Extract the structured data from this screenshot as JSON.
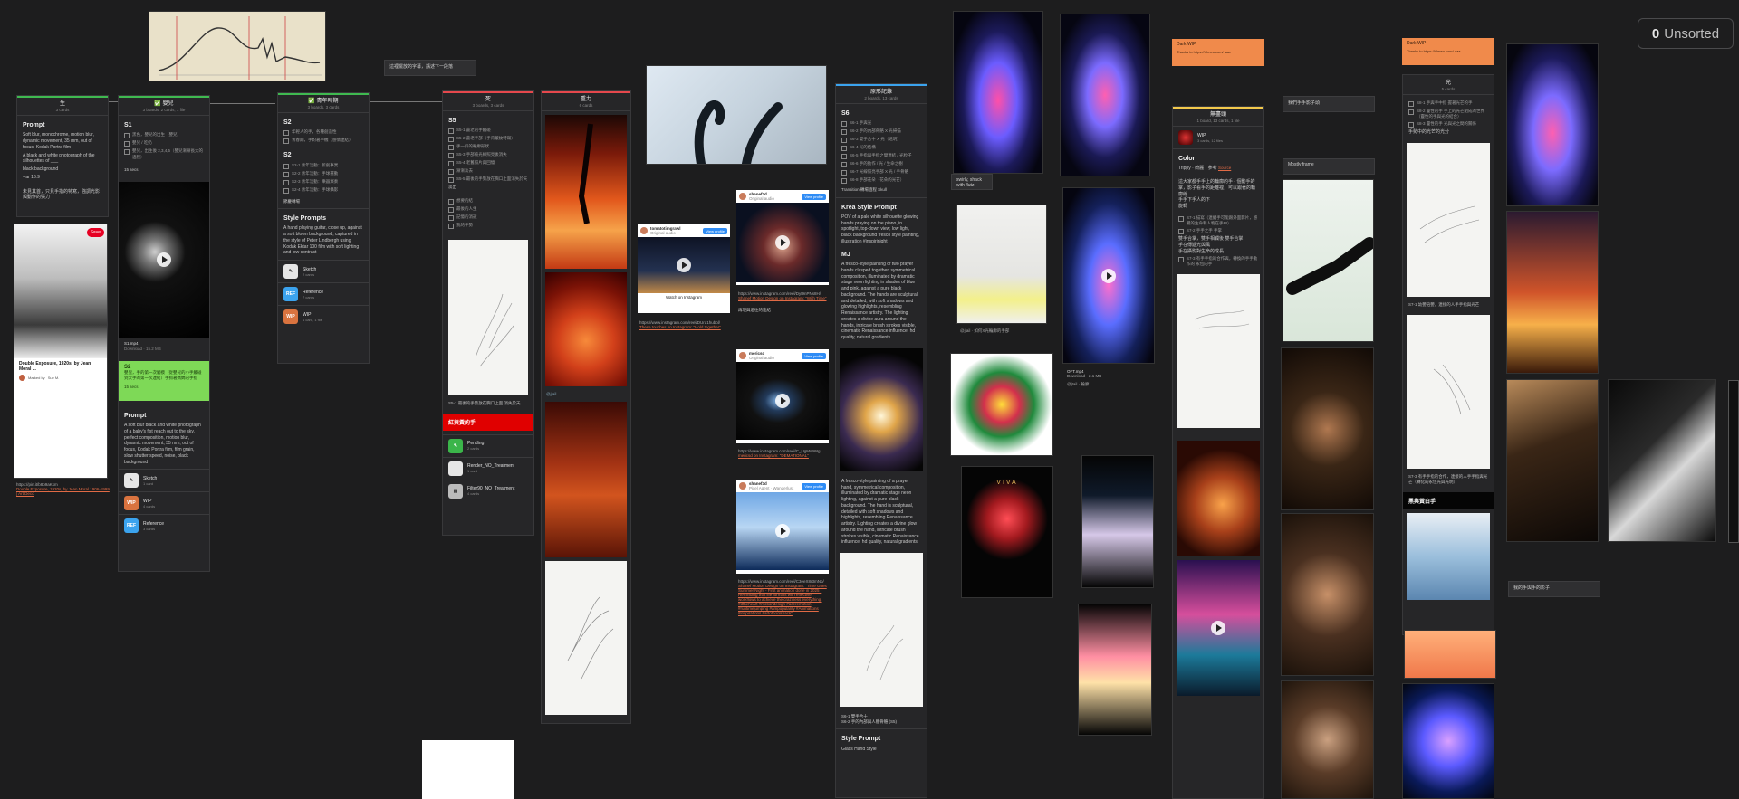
{
  "unsorted": {
    "count": "0",
    "label": "Unsorted"
  },
  "boards": {
    "col1": {
      "title": "生",
      "sub": "3 cards",
      "prompt_heading": "Prompt",
      "prompt_text": "Soft blur, monochrome, motion blur, dynamic movement, 35 mm, out of focus, Kodak Portra film",
      "prompt_text2": "A black and white photograph of the silhouettes of ___",
      "prompt_text3": "black background",
      "prompt_text4": "--ar 16:9",
      "footer_text": "未見其首，只見手指的特寫，強調光影與動作的張力"
    },
    "col2": {
      "title": "✅ 嬰兒",
      "sub": "3 boards, 2 cards, 1 file",
      "s1": "S1",
      "items": [
        "黑色，嬰兒的出生（嬰兒）",
        "嬰兒 / 吃奶",
        "嬰兒，出生後 2,3,4,5（嬰兒漸漸長大的過程）"
      ],
      "seconds": "15 secs",
      "video_file": "S1.mp4",
      "video_meta": "Download · 15.2 MB",
      "s2_title": "S2",
      "s2_text": "嬰兒，手的第一次觸摸（從嬰兒的小手觸碰到大手的第一次連結）手抓著媽媽的手指",
      "s2_secs": "15 secs",
      "prompt_heading": "Prompt",
      "prompt_text": "A soft blur black and white photograph of a baby's fist reach out to the sky, perfect composition, motion blur, dynamic movement, 35 mm, out of focus, Kodak Portra film, film grain, slow shutter speed, noise, black background",
      "subboards": [
        {
          "name": "Sketch",
          "count": "1 card",
          "color": "#e6e6e6",
          "abbr": ""
        },
        {
          "name": "WIP",
          "count": "4 cards",
          "color": "#d9733f",
          "abbr": "WIP"
        },
        {
          "name": "Reference",
          "count": "3 cards",
          "color": "#3ba3ee",
          "abbr": "REF"
        }
      ]
    },
    "col3": {
      "title": "✅ 青年時期",
      "sub": "3 boards, 3 cards",
      "s2": "S2",
      "items1": [
        "年輕人的手，各種創造性",
        "青春期，手對著手機（感情連結）"
      ],
      "s2b": "S2",
      "items2": [
        "S2-1 青年活動：新創事業",
        "S2-2 青年活動：手球運動",
        "S2-3 青年活動：樂器演奏",
        "S2-4 青年活動：手球攝影"
      ],
      "extra": "節慶轉場",
      "style_heading": "Style Prompts",
      "style_text": "A hand playing guitar, close up, against a soft blown background, captured in the style of Peter Lindbergh using Kodak Ektar 100 film with soft lighting and low contrast",
      "subboards": [
        {
          "name": "Sketch",
          "count": "2 cards",
          "color": "#e6e6e6",
          "abbr": ""
        },
        {
          "name": "Reference",
          "count": "7 cards",
          "color": "#3ba3ee",
          "abbr": "REF"
        },
        {
          "name": "WIP",
          "count": "1 card, 1 file",
          "color": "#d9733f",
          "abbr": "WIP"
        }
      ]
    },
    "col4": {
      "title": "死",
      "sub": "3 boards, 3 cards",
      "s5": "S5",
      "items": [
        "S5-1 蒼老的手觸碰",
        "S5-2 蒼老手部（手背皺紋特寫）",
        "手一抖的輪廓形狀",
        "S5-3 手部被光線照亮後消失",
        "S5-4 老舊照片與回憶",
        "漸漸淡去",
        "S5-5 最後的手勢放在胸口上面消失於天"
      ],
      "fade": "淡出",
      "items2": [
        "想要的結",
        "最後的人生",
        "記憶的消逝",
        "我的手勢"
      ],
      "sketch_note": "S5-1 最後的手勢放在胸口上面 消失於天",
      "red_banner": "紅與黃的手",
      "subboards": [
        {
          "name": "Pending",
          "count": "2 cards",
          "color": "#3bb54a",
          "abbr": ""
        },
        {
          "name": "Render_NO_Treatment",
          "count": "1 card",
          "color": "#e6e6e6",
          "abbr": ""
        },
        {
          "name": "Filter90_NO_Treatment",
          "count": "4 cards",
          "color": "#bbbbbb",
          "abbr": ""
        }
      ]
    },
    "col5": {
      "title": "重力",
      "sub": "6 cards",
      "tag": "@jtail"
    },
    "col6": {
      "title": "原形記錄",
      "sub": "2 boards, 13 cards",
      "s6": "S6",
      "items": [
        "S6-1 手與光",
        "S6-2 手的內部骨骼 X 光掃描",
        "S6-3 雙手合十 X 光（透明）",
        "S6-4 光的結構",
        "S6-5 手指與手指之間連結 / 光粒子",
        "S6-6 手的動作 / 光 / 生命之樹",
        "S6-7 光線照亮手部 X 光 / 手骨骼",
        "S6-8 手部花朵（花朵的光芒）"
      ],
      "transition": "Transition 轉場過程 Skull",
      "krea_heading": "Krea Style Prompt",
      "krea_text": "POV of a pale white silhouette glowing hands praying on the piano, in spotlight, top-down view, low light, black background fresco style painting, illustration #inspirinight",
      "mj_heading": "MJ",
      "mj_text": "A fresco-style painting of two prayer hands clasped together, symmetrical composition, illuminated by dramatic stage neon lighting in shades of blue and pink, against a pure black background. The hands are sculptural and detailed, with soft shadows and glowing highlights, resembling Renaissance artistry. The lighting creates a divine aura around the hands, intricate brush strokes visible, cinematic Renaissance influence, hd quality, natural gradients.",
      "fresco_text": "A fresco-style painting of a prayer hand, symmetrical composition, illuminated by dramatic stage neon lighting, against a pure black background. The hand is sculptural, detailed with soft shadows and highlights, resembling Renaissance artistry. Lighting creates a divine glow around the hand, intricate brush strokes visible, cinematic Renaissance influence, hd quality, natural gradients.",
      "bottom_note": "S6-1 雙手合十\nS6-2 手的內部與人體骨骼 (S5)",
      "style_heading": "Style Prompt",
      "style_sub": "Glass Hand Style"
    },
    "col8": {
      "title": "無盡頭",
      "sub": "1 board, 13 cards, 1 file",
      "wip_name": "WIP",
      "wip_count": "3 cards, 12 files",
      "color_heading": "Color",
      "color_text": "Trippy · 綺麗 · 參考",
      "color_link": "Source",
      "body1": "這大家都手手上的輪廓的手 - 個動手的掌，影子看手的距離裡，可以跟著的輪廓線",
      "body2": "手手下手人的下",
      "body3": "旋轉",
      "checks": [
        "S7-1 描寫（連續手可能跟外面影片，感覺的生命和人物在手中）",
        "S7-2 手手之手 手掌"
      ],
      "body4": "雙手合掌，雙手相觸後 雙手合掌",
      "body5": "手在傳遞光與風",
      "body6": "手在攝影對生命的成長",
      "check2": "S7-3 有手手指的合作與，轉換的手手動作的 永恆的手"
    }
  },
  "notes": {
    "n1": "這裡擺放的字幕，講述下一段落",
    "n2": "swirly, shack with flutz",
    "n3": "我們手手影子頭",
    "n4": "Mostly frame",
    "n5": "我的手與手的影子"
  },
  "connectors_label": "",
  "captions": {
    "pinterest_url": "https://pin.it/b8p9aKkm",
    "pinterest_link": "Double Exposure, 1920s, by Jean Moral 1906-1999 | Art Deco",
    "pin_title": "Double Exposure, 1920s, by Jean Moral ...",
    "pin_by": "Marked by",
    "pin_user": "Sue M.",
    "ig1_user": "tomatotimgrawl",
    "ig1_sub": "Original audio",
    "ig1_follow": "View profile",
    "ig1_watch": "Watch on Instagram",
    "ig1_url": "https://www.instagram.com/reel/DUrd1hubbl/",
    "ig1_link": "These touches on Instagram: \"Hold together\"",
    "ig2_user": "shanef3d",
    "ig2_sub": "Original audio",
    "ig2_follow": "View profile",
    "ig2_url": "https://www.instagram.com/reel/DyI9nPNs8H/",
    "ig2_link": "Shanef Motion Design on Instagram: \"With Time\"",
    "ig2_caption": "再現與過往的連結",
    "ig3_user": "mericsd",
    "ig3_sub": "Original audio",
    "ig3_follow": "View profile",
    "ig3_url": "https://www.instagram.com/reel/C_UgMs9Wg",
    "ig3_link": "mericsd on Instagram: \"DEMATIONAL\"",
    "ig4_user": "shanef3d",
    "ig4_sub": "Pixel Agent · Wanderlust",
    "ig4_follow": "View profile",
    "ig4_url": "https://www.instagram.com/reel/C3eeX8r3mNo/",
    "ig4_link": "Shanef Motion Design on Instagram: \"Time Goes Summer Night - First animation done in 2025 - Reminding that life formats with effective workflows to achieve the craziness everything. #dtheheart #motiondesign #aceremotion #runtimejumping #ampopularity #Animations #inspirations #artofhoolsback\"",
    "mp4_file": "OFT.mp4",
    "mp4_meta": "Download · 2.1 MB",
    "mp4_tag": "@jtail · 輪廓",
    "gears_tag": "@jtail · 如何X光輪廓的手部",
    "wide_caption": "S7-1 幼嬰陪嬰，連接的人手手指與光芒",
    "light_caption": "光影和光中心",
    "sketch_caption": "S7-3 有手手指的合作，連接的人手手指與光芒（轉化的永恆光與光明）",
    "black_banner": "黑與黃白手",
    "orange1_title": "Dark WIP",
    "orange1_text": "Thanks to https://Vimeo.com/ aaa",
    "orange2_title": "Dark WIP",
    "orange2_text": "Thanks to https://Vimeo.com/ aaa",
    "col9_title": "光",
    "col9_sub": "5 cards",
    "col9_items": [
      "S8-1 手與手中指 握著光芒的手",
      "S8-2 靈性的手 手上的光芒組成的世界（靈性的手與光的結合）",
      "S8-3 靈性的手 光與光之間的關係"
    ],
    "col9_foot": "手勢中的光芒的光分"
  }
}
